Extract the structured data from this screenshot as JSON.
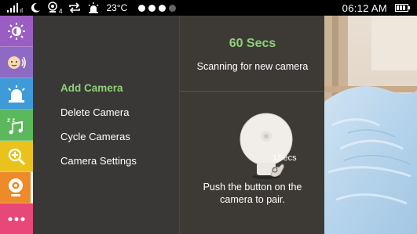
{
  "status_bar": {
    "temperature": "23°C",
    "time": "06:12 AM",
    "icons": [
      "signal-icon",
      "moon-icon",
      "camera-count-icon",
      "repeat-icon",
      "alarm-icon"
    ],
    "camera_count": "4",
    "page_dots": 4,
    "page_dots_active": 3
  },
  "sidebar": {
    "items": [
      {
        "name": "brightness",
        "icon": "brightness-icon",
        "color": "#9a5ec2"
      },
      {
        "name": "talk",
        "icon": "baby-talk-icon",
        "color": "#8e6ac4"
      },
      {
        "name": "alarm",
        "icon": "alarm-icon",
        "color": "#3f9bd8"
      },
      {
        "name": "lullaby",
        "icon": "music-icon",
        "color": "#5cb85c"
      },
      {
        "name": "zoom",
        "icon": "zoom-icon",
        "color": "#eac21c"
      },
      {
        "name": "camera",
        "icon": "camera-icon",
        "color": "#ee8a2a",
        "active": true
      },
      {
        "name": "more",
        "icon": "more-icon",
        "color": "#e8477a"
      }
    ]
  },
  "menu": {
    "items": [
      "Add Camera",
      "Delete Camera",
      "Cycle Cameras",
      "Camera Settings"
    ],
    "selected": "Add Camera"
  },
  "info": {
    "countdown": "60 Secs",
    "scanning": "Scanning for new camera",
    "press_time": "1Secs",
    "instruction_line1": "Push the button on the",
    "instruction_line2": "camera to pair."
  },
  "colors": {
    "accent_green": "#8fd07a",
    "panel": "#3a3836"
  }
}
